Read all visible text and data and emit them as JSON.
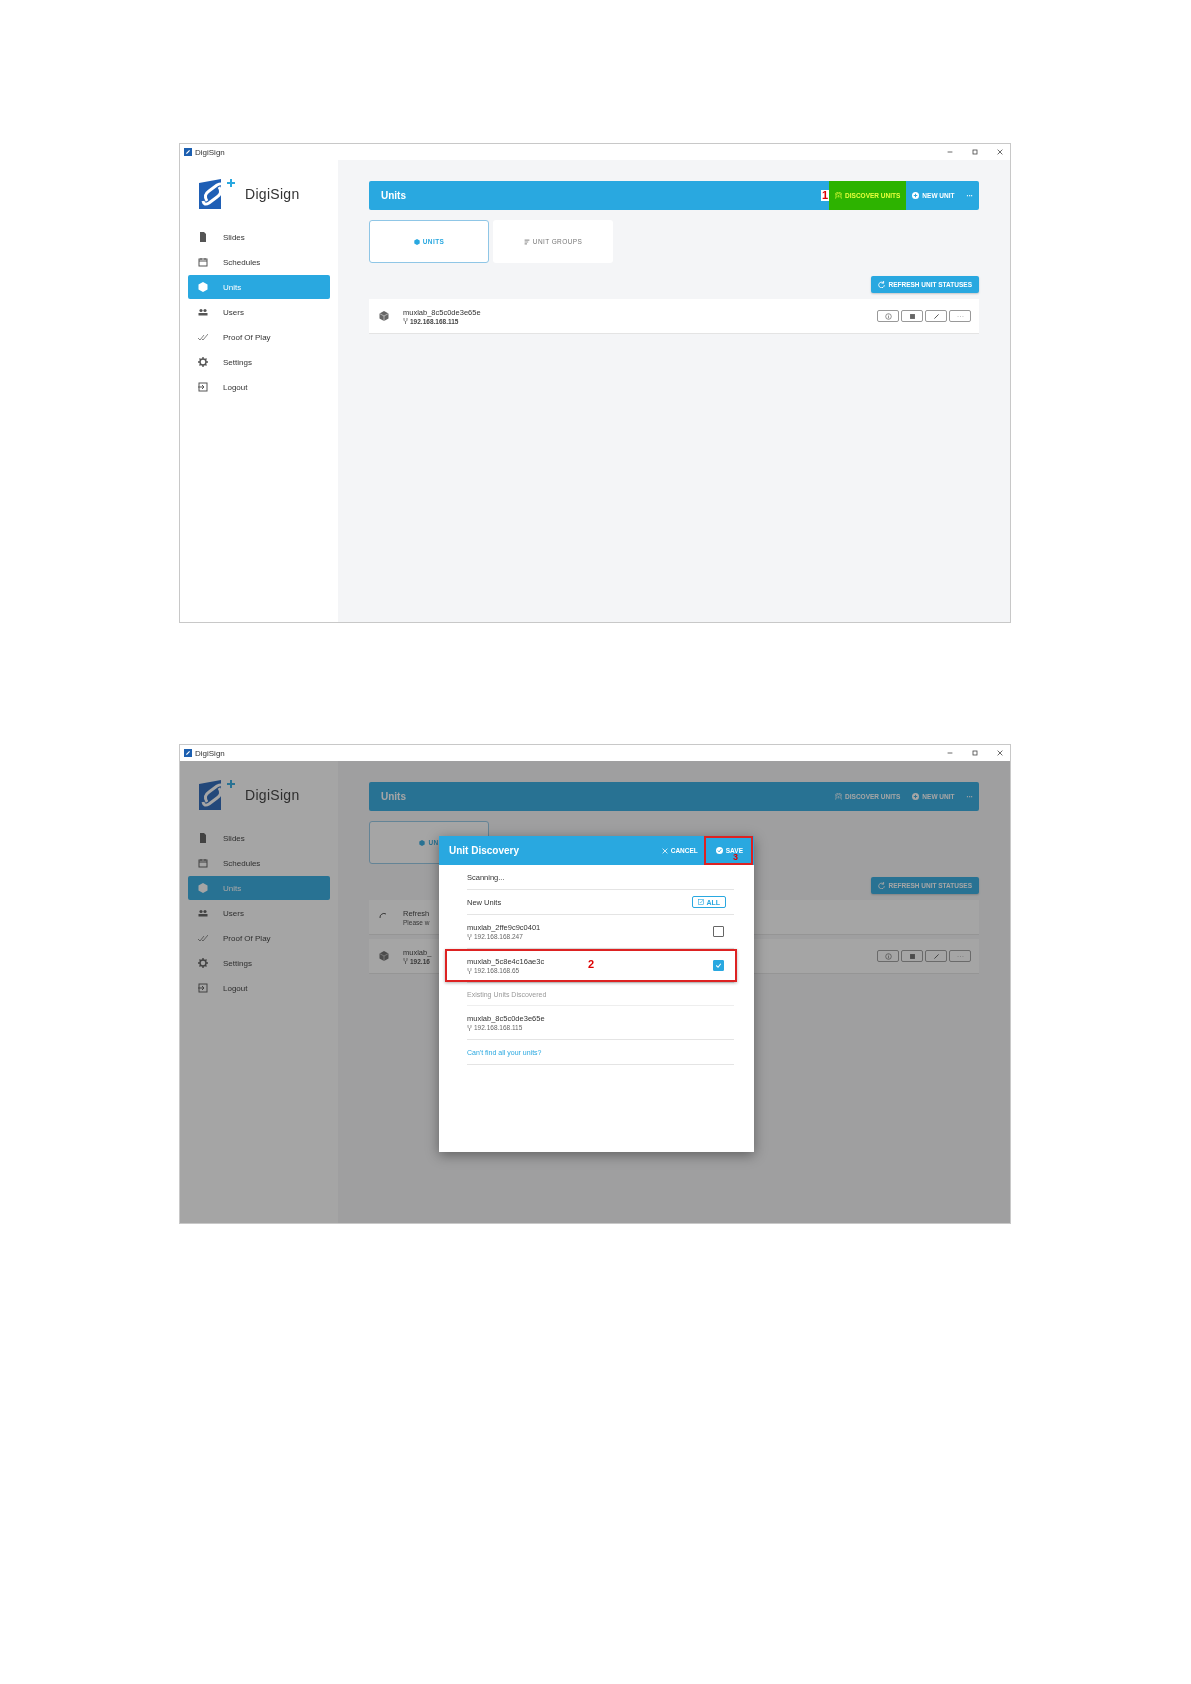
{
  "screens": [
    {
      "window": {
        "title": "DigiSign"
      },
      "brand": "DigiSign",
      "sidebar": {
        "items": [
          {
            "label": "Slides",
            "selected": false
          },
          {
            "label": "Schedules",
            "selected": false
          },
          {
            "label": "Units",
            "selected": true
          },
          {
            "label": "Users",
            "selected": false
          },
          {
            "label": "Proof Of Play",
            "selected": false
          },
          {
            "label": "Settings",
            "selected": false
          },
          {
            "label": "Logout",
            "selected": false
          }
        ]
      },
      "header": {
        "title": "Units",
        "actions": [
          {
            "kind": "discover",
            "label": "DISCOVER UNITS",
            "callout": "1"
          },
          {
            "kind": "new",
            "label": "NEW UNIT"
          },
          {
            "kind": "more",
            "label": "···"
          }
        ]
      },
      "tabs": [
        {
          "kind": "units",
          "label": "UNITS",
          "selected": true
        },
        {
          "kind": "groups",
          "label": "UNIT GROUPS",
          "selected": false
        }
      ],
      "refresh_button": "REFRESH UNIT STATUSES",
      "rows": [
        {
          "kind": "unit",
          "name": "muxlab_8c5c0de3e65e",
          "ip": "192.168.168.115"
        }
      ]
    },
    {
      "window": {
        "title": "DigiSign"
      },
      "brand": "DigiSign",
      "sidebar": {
        "items": [
          {
            "label": "Slides",
            "selected": false
          },
          {
            "label": "Schedules",
            "selected": false
          },
          {
            "label": "Units",
            "selected": true
          },
          {
            "label": "Users",
            "selected": false
          },
          {
            "label": "Proof Of Play",
            "selected": false
          },
          {
            "label": "Settings",
            "selected": false
          },
          {
            "label": "Logout",
            "selected": false
          }
        ]
      },
      "header": {
        "title": "Units",
        "actions": [
          {
            "kind": "discover",
            "label": "DISCOVER UNITS"
          },
          {
            "kind": "new",
            "label": "NEW UNIT"
          },
          {
            "kind": "more",
            "label": "···"
          }
        ]
      },
      "tabs": [
        {
          "kind": "units",
          "label": "UN",
          "selected": true
        }
      ],
      "refresh_button": "REFRESH UNIT STATUSES",
      "rows": [
        {
          "kind": "progress",
          "name": "Refresh",
          "ip": "Please w"
        },
        {
          "kind": "unit",
          "name": "muxlab_",
          "ip": "192.16"
        }
      ],
      "dialog": {
        "title": "Unit Discovery",
        "cancel": "CANCEL",
        "save": "SAVE",
        "save_callout": "3",
        "status": "Scanning...",
        "new_heading": "New Units",
        "all_button": "ALL",
        "new_units": [
          {
            "name": "muxlab_2ffe9c9c0401",
            "ip": "192.168.168.247",
            "checked": false
          },
          {
            "name": "muxlab_5c8e4c16ae3c",
            "ip": "192.168.168.65",
            "checked": true,
            "callout": "2"
          }
        ],
        "existing_heading": "Existing Units Discovered",
        "existing_units": [
          {
            "name": "muxlab_8c5c0de3e65e",
            "ip": "192.168.168.115"
          }
        ],
        "help_link": "Can't find all your units?"
      }
    }
  ]
}
